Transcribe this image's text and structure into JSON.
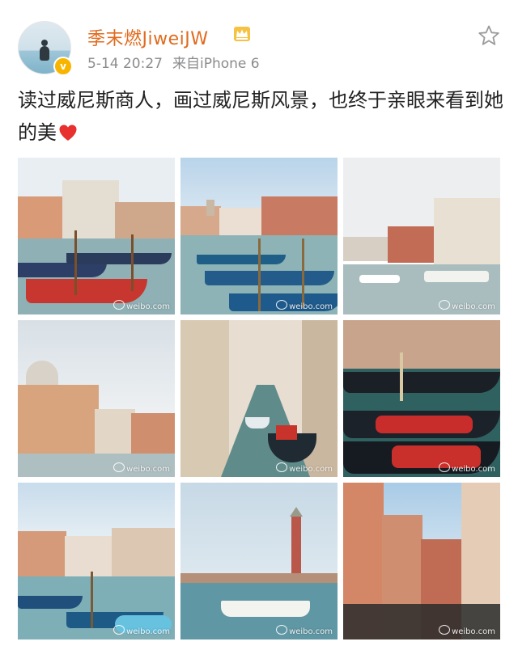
{
  "header": {
    "username": "季末燃JiweiJW",
    "time": "5-14 20:27",
    "source": "来自iPhone 6"
  },
  "post": {
    "text": "读过威尼斯商人，画过威尼斯风景，也终于亲眼来看到她的美"
  },
  "icons": {
    "crown": "vip-crown-icon",
    "star": "star-outline-icon",
    "heart": "red-heart-emoji",
    "verified": "verified-v-badge"
  },
  "images": [
    {
      "watermark": "weibo.com"
    },
    {
      "watermark": "weibo.com"
    },
    {
      "watermark": "weibo.com"
    },
    {
      "watermark": "weibo.com"
    },
    {
      "watermark": "weibo.com"
    },
    {
      "watermark": "weibo.com"
    },
    {
      "watermark": "weibo.com"
    },
    {
      "watermark": "weibo.com"
    },
    {
      "watermark": "weibo.com"
    }
  ],
  "colors": {
    "username": "#e06b1f",
    "meta": "#8c8c8c",
    "text": "#222222",
    "heart": "#e8302f"
  }
}
